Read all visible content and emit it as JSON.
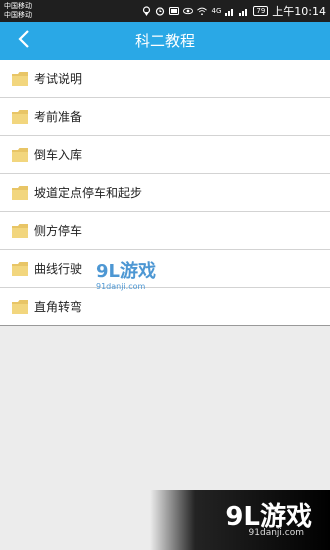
{
  "status": {
    "carrier_1": "中国移动",
    "carrier_2": "中国移动",
    "net_label": "4G",
    "battery": "79",
    "time": "上午10:14"
  },
  "header": {
    "title": "科二教程"
  },
  "items": [
    {
      "label": "考试说明"
    },
    {
      "label": "考前准备"
    },
    {
      "label": "倒车入库"
    },
    {
      "label": "坡道定点停车和起步"
    },
    {
      "label": "侧方停车"
    },
    {
      "label": "曲线行驶"
    },
    {
      "label": "直角转弯"
    }
  ],
  "watermark": {
    "brand": "9L游戏",
    "site": "91danji.com"
  },
  "colors": {
    "accent": "#2aa8e6",
    "folder": "#e8c566"
  }
}
